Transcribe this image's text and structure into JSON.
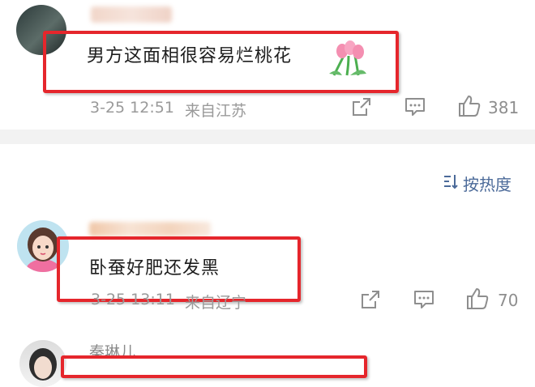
{
  "comments": [
    {
      "text": "男方这面相很容易烂桃花",
      "time": "3-25 12:51",
      "location": "来自江苏",
      "likes": "381",
      "emoji": "tulip-bouquet"
    },
    {
      "text": "卧蚕好肥还发黑",
      "time": "3-25 13:11",
      "location": "来自辽宁",
      "likes": "70"
    },
    {
      "username": "秦琳儿"
    }
  ],
  "sort": {
    "label": "按热度",
    "icon": "sort-icon"
  },
  "colors": {
    "highlight": "#e5262c",
    "meta": "#9a9a9a",
    "divider": "#f2f2f2"
  }
}
